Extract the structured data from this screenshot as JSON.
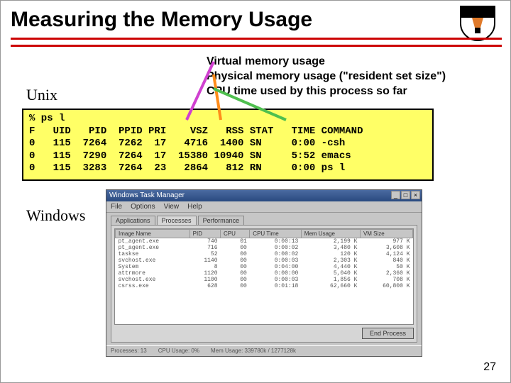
{
  "title": "Measuring the Memory Usage",
  "desc_lines": [
    "Virtual memory usage",
    "Physical memory usage (\"resident set size\")",
    "CPU time used by this process so far"
  ],
  "labels": {
    "unix": "Unix",
    "windows": "Windows"
  },
  "term_cmd": "% ps l",
  "term_header": "F   UID   PID  PPID PRI    VSZ   RSS STAT   TIME COMMAND",
  "term_rows": [
    "0   115  7264  7262  17   4716  1400 SN     0:00 -csh",
    "0   115  7290  7264  17  15380 10940 SN     5:52 emacs",
    "0   115  3283  7264  23   2864   812 RN     0:00 ps l"
  ],
  "win": {
    "title": "Windows Task Manager",
    "menu": [
      "File",
      "Options",
      "View",
      "Help"
    ],
    "tabs": [
      "Applications",
      "Processes",
      "Performance"
    ],
    "cols": [
      "Image Name",
      "PID",
      "CPU",
      "CPU Time",
      "Mem Usage",
      "VM Size"
    ],
    "rows": [
      [
        "pt_agent.exe",
        "740",
        "01",
        "0:00:13",
        "2,199 K",
        "977 K"
      ],
      [
        "pt_agent.exe",
        "716",
        "00",
        "0:00:02",
        "3,480 K",
        "3,608 K"
      ],
      [
        "taskse",
        "52",
        "00",
        "0:00:02",
        "120 K",
        "4,124 K"
      ],
      [
        "svchost.exe",
        "1140",
        "00",
        "0:00:03",
        "2,303 K",
        "840 K"
      ],
      [
        "System",
        "8",
        "00",
        "0:04:00",
        "4,440 K",
        "50 K"
      ],
      [
        "attrmore",
        "1120",
        "00",
        "0:00:00",
        "5,040 K",
        "2,360 K"
      ],
      [
        "svchost.exe",
        "1100",
        "00",
        "0:00:03",
        "1,856 K",
        "708 K"
      ],
      [
        "csrss.exe",
        "628",
        "00",
        "0:01:18",
        "62,660 K",
        "60,800 K"
      ]
    ],
    "endproc": "End Process",
    "status": [
      "Processes: 13",
      "CPU Usage: 0%",
      "Mem Usage: 339780k / 1277128k"
    ]
  },
  "chart_data": {
    "type": "table",
    "title": "ps l output",
    "columns": [
      "F",
      "UID",
      "PID",
      "PPID",
      "PRI",
      "VSZ",
      "RSS",
      "STAT",
      "TIME",
      "COMMAND"
    ],
    "rows": [
      [
        "0",
        "115",
        "7264",
        "7262",
        "17",
        "4716",
        "1400",
        "SN",
        "0:00",
        "-csh"
      ],
      [
        "0",
        "115",
        "7290",
        "7264",
        "17",
        "15380",
        "10940",
        "SN",
        "5:52",
        "emacs"
      ],
      [
        "0",
        "115",
        "3283",
        "7264",
        "23",
        "2864",
        "812",
        "RN",
        "0:00",
        "ps l"
      ]
    ]
  },
  "pagenum": "27"
}
